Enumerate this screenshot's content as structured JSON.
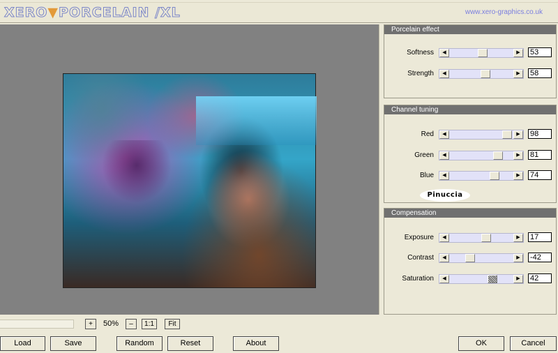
{
  "app": {
    "logo_part1": "XERO",
    "logo_part2": "PORCELAIN /XL",
    "url": "www.xero-graphics.co.uk"
  },
  "panels": {
    "porcelain": {
      "title": "Porcelain effect",
      "sliders": [
        {
          "label": "Softness",
          "value": "53",
          "position": 0.53
        },
        {
          "label": "Strength",
          "value": "58",
          "position": 0.58
        }
      ]
    },
    "channel": {
      "title": "Channel tuning",
      "sliders": [
        {
          "label": "Red",
          "value": "98",
          "position": 0.98
        },
        {
          "label": "Green",
          "value": "81",
          "position": 0.81
        },
        {
          "label": "Blue",
          "value": "74",
          "position": 0.74
        }
      ],
      "watermark": "Pinuccia"
    },
    "compensation": {
      "title": "Compensation",
      "sliders": [
        {
          "label": "Exposure",
          "value": "17",
          "position": 0.585
        },
        {
          "label": "Contrast",
          "value": "-42",
          "position": 0.29
        },
        {
          "label": "Saturation",
          "value": "42",
          "position": 0.71
        }
      ]
    }
  },
  "zoom": {
    "plus": "+",
    "value": "50%",
    "minus": "–",
    "one_to_one": "1:1",
    "fit": "Fit"
  },
  "buttons": {
    "load": "Load",
    "save": "Save",
    "random": "Random",
    "reset": "Reset",
    "about": "About",
    "ok": "OK",
    "cancel": "Cancel"
  }
}
